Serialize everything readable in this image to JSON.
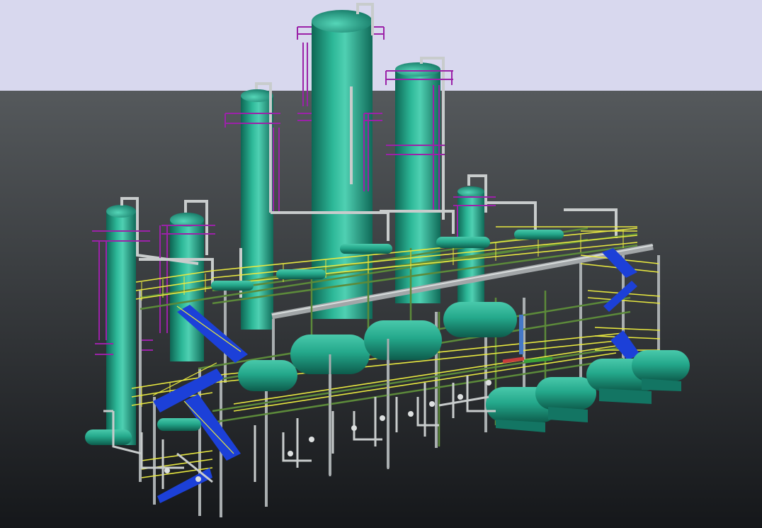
{
  "scene": {
    "description_visible_text": "",
    "colors": {
      "sky": "#d8d8ee",
      "ground_top": "#4e5256",
      "ground_bottom": "#16181a",
      "vessel": "#1e9c84",
      "vessel_highlight": "#5fd3b8",
      "vessel_shadow": "#0f6a58",
      "platform_rail": "#e8e840",
      "structure": "#a9aeb0",
      "ladder_cage": "#9b22a8",
      "stair": "#1c40d8",
      "pipe": "#c8cccc",
      "pipe_green": "#3aa03a",
      "valve_red": "#c83c3c"
    }
  }
}
